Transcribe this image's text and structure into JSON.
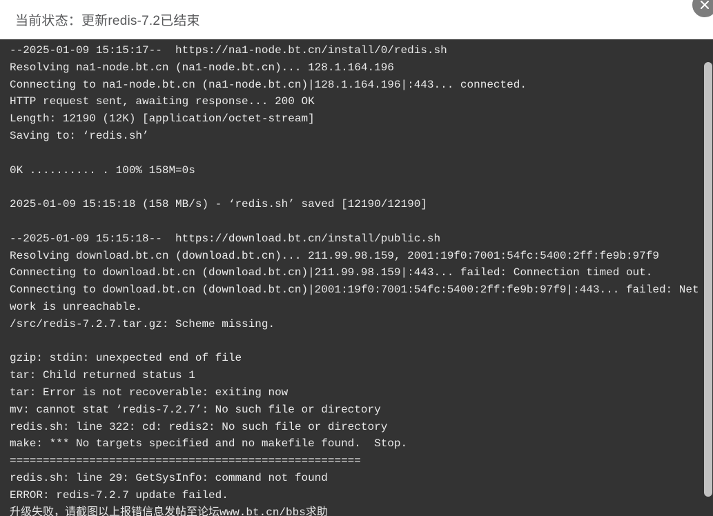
{
  "header": {
    "title": "当前状态：更新redis-7.2已结束",
    "close_icon": "close-icon"
  },
  "colors": {
    "header_bg": "#ffffff",
    "header_text": "#58595b",
    "terminal_bg": "#333333",
    "terminal_text": "#e9e9e9",
    "close_button_bg": "#7d7d7d",
    "scrollbar_thumb": "#c2c2c2"
  },
  "terminal": {
    "lines": [
      "--2025-01-09 15:15:17--  https://na1-node.bt.cn/install/0/redis.sh",
      "Resolving na1-node.bt.cn (na1-node.bt.cn)... 128.1.164.196",
      "Connecting to na1-node.bt.cn (na1-node.bt.cn)|128.1.164.196|:443... connected.",
      "HTTP request sent, awaiting response... 200 OK",
      "Length: 12190 (12K) [application/octet-stream]",
      "Saving to: ‘redis.sh’",
      "",
      "0K .......... . 100% 158M=0s",
      "",
      "2025-01-09 15:15:18 (158 MB/s) - ‘redis.sh’ saved [12190/12190]",
      "",
      "--2025-01-09 15:15:18--  https://download.bt.cn/install/public.sh",
      "Resolving download.bt.cn (download.bt.cn)... 211.99.98.159, 2001:19f0:7001:54fc:5400:2ff:fe9b:97f9",
      "Connecting to download.bt.cn (download.bt.cn)|211.99.98.159|:443... failed: Connection timed out.",
      "Connecting to download.bt.cn (download.bt.cn)|2001:19f0:7001:54fc:5400:2ff:fe9b:97f9|:443... failed: Network is unreachable.",
      "/src/redis-7.2.7.tar.gz: Scheme missing.",
      "",
      "gzip: stdin: unexpected end of file",
      "tar: Child returned status 1",
      "tar: Error is not recoverable: exiting now",
      "mv: cannot stat ‘redis-7.2.7’: No such file or directory",
      "redis.sh: line 322: cd: redis2: No such file or directory",
      "make: *** No targets specified and no makefile found.  Stop.",
      "=====================================================",
      "redis.sh: line 29: GetSysInfo: command not found",
      "ERROR: redis-7.2.7 update failed.",
      "升级失败，请截图以上报错信息发帖至论坛www.bt.cn/bbs求助"
    ]
  },
  "scrollbar": {
    "orientation": "vertical"
  }
}
